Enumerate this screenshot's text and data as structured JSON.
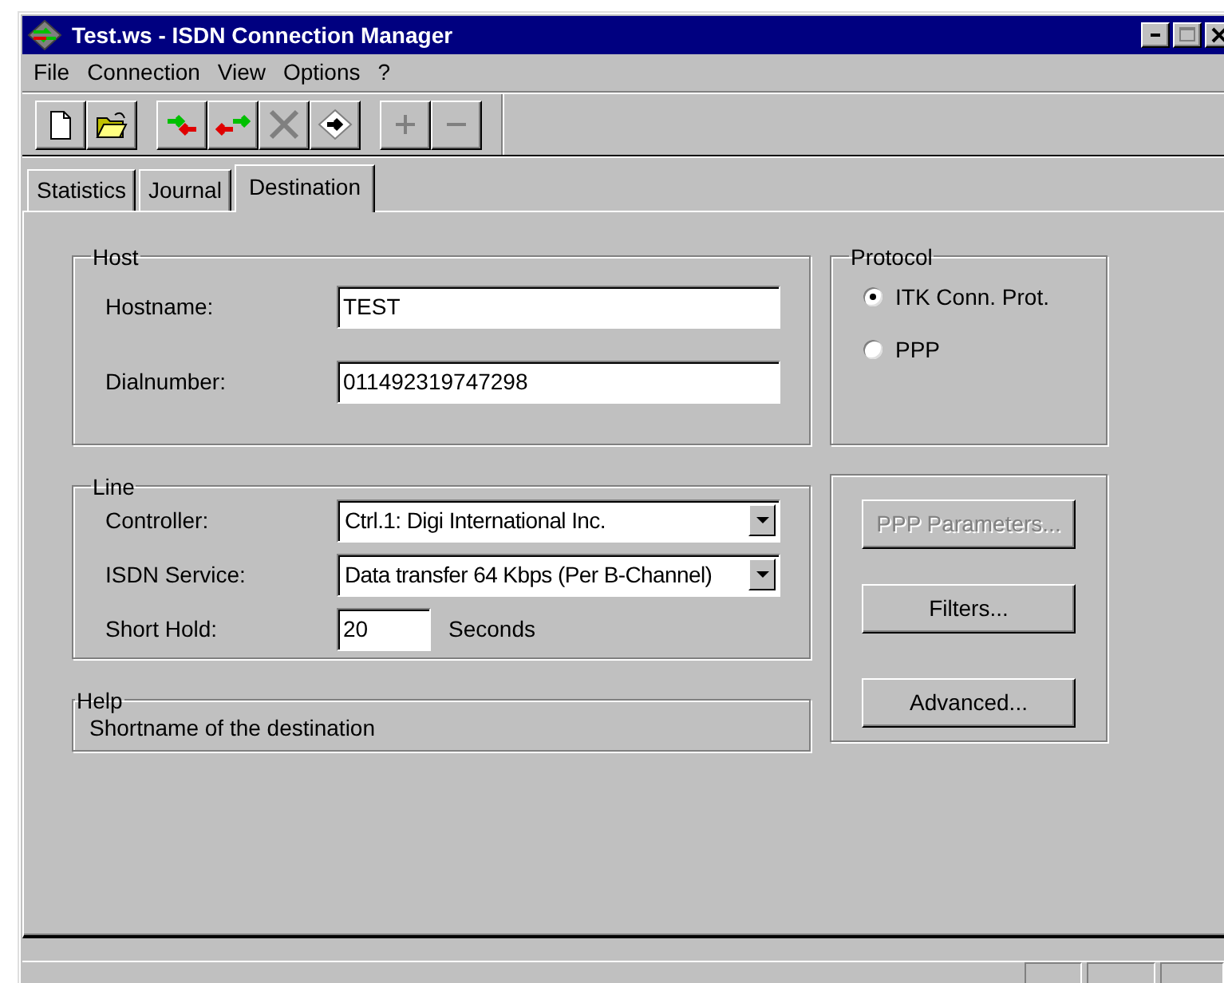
{
  "window": {
    "title": "Test.ws - ISDN Connection Manager"
  },
  "menu": [
    {
      "label": "File"
    },
    {
      "label": "Connection"
    },
    {
      "label": "View"
    },
    {
      "label": "Options"
    },
    {
      "label": "?"
    }
  ],
  "toolbar": {
    "groups": [
      {
        "buttons": [
          {
            "kind": "new",
            "disabled": false
          },
          {
            "kind": "open",
            "disabled": false
          }
        ]
      },
      {
        "buttons": [
          {
            "kind": "connect",
            "disabled": false
          },
          {
            "kind": "swap",
            "disabled": false
          },
          {
            "kind": "disconnect",
            "disabled": true
          },
          {
            "kind": "goto",
            "disabled": false
          }
        ]
      },
      {
        "buttons": [
          {
            "kind": "add",
            "disabled": true
          },
          {
            "kind": "remove",
            "disabled": true
          }
        ]
      }
    ]
  },
  "tabs": [
    {
      "label": "Statistics",
      "selected": false
    },
    {
      "label": "Journal",
      "selected": false
    },
    {
      "label": "Destination",
      "selected": true
    }
  ],
  "host": {
    "title": "Host",
    "fields": [
      {
        "label": "Hostname:",
        "value": "TEST"
      },
      {
        "label": "Dialnumber:",
        "value": "011492319747298"
      }
    ]
  },
  "protocol": {
    "title": "Protocol",
    "options": [
      {
        "label": "ITK Conn. Prot.",
        "selected": true
      },
      {
        "label": "PPP",
        "selected": false
      }
    ]
  },
  "line": {
    "title": "Line",
    "rows": [
      {
        "kind": "select",
        "label": "Controller:",
        "value": "Ctrl.1: Digi International Inc."
      },
      {
        "kind": "select",
        "label": "ISDN Service:",
        "value": "Data transfer 64 Kbps (Per B-Channel)"
      },
      {
        "kind": "input",
        "label": "Short Hold:",
        "value": "20",
        "unit": "Seconds"
      }
    ]
  },
  "help": {
    "title": "Help",
    "text": "Shortname of the destination"
  },
  "buttons": [
    {
      "label": "PPP Parameters...",
      "disabled": true
    },
    {
      "label": "Filters...",
      "disabled": false
    },
    {
      "label": "Advanced...",
      "disabled": false
    }
  ]
}
